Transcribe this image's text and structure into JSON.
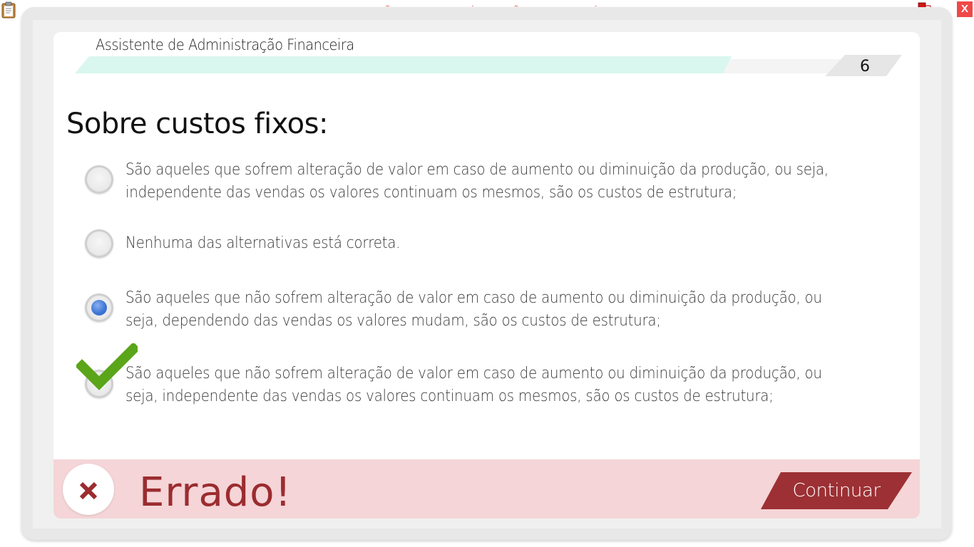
{
  "banner": {
    "text": "VERSÃO PARA FUNCIONÁRIOS - NÃO COMERCIALIZÁVEL"
  },
  "window": {
    "close_label": "X"
  },
  "header": {
    "title": "Assistente de Administração Financeira",
    "progress_fraction": 0.79,
    "question_number": "6"
  },
  "question": {
    "text": "Sobre custos fixos:",
    "options": [
      {
        "line1": "São aqueles que sofrem alteração de valor em caso de aumento ou diminuição da produção, ou seja,",
        "line2": "independente das vendas os valores continuam os mesmos, são os custos de estrutura;",
        "selected": false,
        "correct": false
      },
      {
        "line1": "Nenhuma das alternativas está correta.",
        "line2": "",
        "selected": false,
        "correct": false
      },
      {
        "line1": "São aqueles que não sofrem alteração de valor em caso de aumento ou diminuição da produção, ou",
        "line2": "seja, dependendo das vendas os valores mudam, são os custos de estrutura;",
        "selected": true,
        "correct": false
      },
      {
        "line1": "São aqueles que não sofrem alteração de valor em caso de aumento ou diminuição da produção, ou",
        "line2": "seja, independente das vendas os valores continuam os mesmos, são os custos de estrutura;",
        "selected": false,
        "correct": true
      }
    ]
  },
  "feedback": {
    "result_text": "Errado!",
    "continue_label": "Continuar"
  },
  "colors": {
    "progress_fill": "#d9f7ee",
    "error_bg": "#f5d5d7",
    "error_text": "#9b2c30",
    "continue_bg": "#9c3034",
    "check_green": "#5aa51a",
    "radio_selected": "#3f78d6"
  },
  "icons": {
    "clipboard": "clipboard-icon",
    "network": "network-status-icon",
    "wrong": "x-mark-icon",
    "correct": "checkmark-icon"
  }
}
